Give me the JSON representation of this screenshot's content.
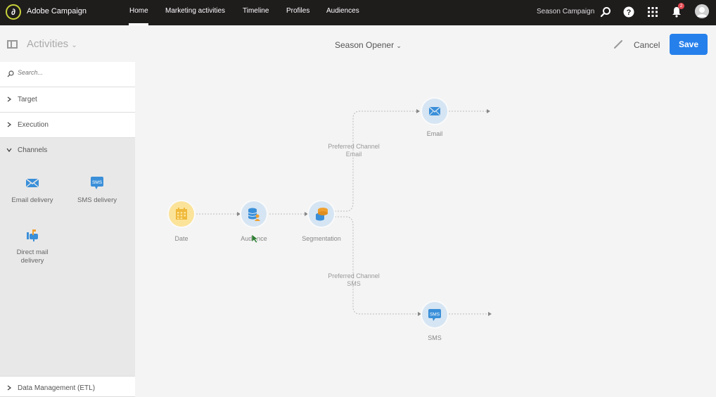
{
  "topbar": {
    "app_title": "Adobe Campaign",
    "nav": [
      "Home",
      "Marketing activities",
      "Timeline",
      "Profiles",
      "Audiences"
    ],
    "active_nav": "Home",
    "campaign": "Season Campaign",
    "notification_count": "2",
    "icons": [
      "search-icon",
      "help-icon",
      "apps-grid-icon",
      "bell-icon",
      "avatar"
    ]
  },
  "subbar": {
    "panel_title": "Activities",
    "workflow_title": "Season Opener",
    "cancel_label": "Cancel",
    "save_label": "Save"
  },
  "sidebar": {
    "search_placeholder": "Search...",
    "sections": [
      {
        "label": "Target",
        "expanded": false
      },
      {
        "label": "Execution",
        "expanded": false
      },
      {
        "label": "Channels",
        "expanded": true
      },
      {
        "label": "Data Management (ETL)",
        "expanded": false
      }
    ],
    "channel_tiles": [
      {
        "label": "Email delivery",
        "icon": "email-icon"
      },
      {
        "label": "SMS delivery",
        "icon": "sms-icon"
      },
      {
        "label": "Direct mail delivery",
        "icon": "mailbox-icon"
      }
    ]
  },
  "workflow": {
    "nodes": [
      {
        "id": "date",
        "label": "Date",
        "icon": "calendar-icon"
      },
      {
        "id": "audience",
        "label": "Audience",
        "icon": "audience-icon"
      },
      {
        "id": "segmentation",
        "label": "Segmentation",
        "icon": "segmentation-icon"
      },
      {
        "id": "email",
        "label": "Email",
        "icon": "email-icon"
      },
      {
        "id": "sms",
        "label": "SMS",
        "icon": "sms-icon"
      }
    ],
    "transitions": [
      {
        "line1": "Preferred Channel",
        "line2": "Email"
      },
      {
        "line1": "Preferred Channel",
        "line2": "SMS"
      }
    ]
  },
  "colors": {
    "accent": "#2680eb",
    "topbar": "#1f1c1c",
    "node_blue": "#d6e5f3",
    "node_yellow": "#fbe39a",
    "icon_blue": "#3a8fd9",
    "icon_orange": "#f0a030"
  }
}
